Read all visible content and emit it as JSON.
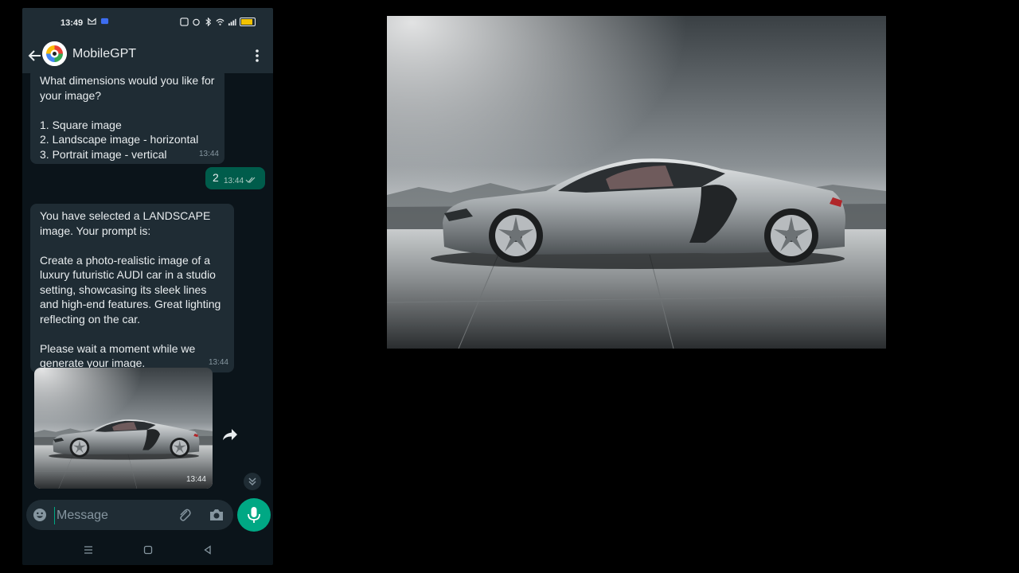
{
  "status_bar": {
    "time": "13:49"
  },
  "chat_header": {
    "title": "MobileGPT"
  },
  "messages": [
    {
      "text": "What dimensions would you like for your image?\n\n1. Square image\n2. Landscape image - horizontal\n3. Portrait image - vertical",
      "time": "13:44"
    },
    {
      "text": "You have selected a LANDSCAPE image. Your prompt is:\n\nCreate a photo-realistic image of a luxury futuristic AUDI car in a studio setting, showcasing its sleek lines and high-end features. Great lighting reflecting on the car.\n\nPlease wait a moment while we generate your image.",
      "time": "13:44"
    }
  ],
  "reply": {
    "text": "2",
    "time": "13:44"
  },
  "image_message": {
    "time": "13:44"
  },
  "composer": {
    "placeholder": "Message"
  },
  "colors": {
    "app_background": "#0b141a",
    "bar": "#1f2c34",
    "incoming_bubble": "#1f2c34",
    "outgoing_bubble": "#005c4b",
    "accent": "#00a884",
    "text": "#e9edef",
    "meta_text": "#8696a0"
  },
  "icons": [
    "back-arrow-icon",
    "bot-avatar",
    "more-vert-icon",
    "double-check-icon",
    "share-icon",
    "double-chevron-down-icon",
    "emoji-icon",
    "paperclip-icon",
    "camera-icon",
    "mic-icon",
    "menu-icon",
    "home-icon",
    "back-triangle-icon"
  ]
}
